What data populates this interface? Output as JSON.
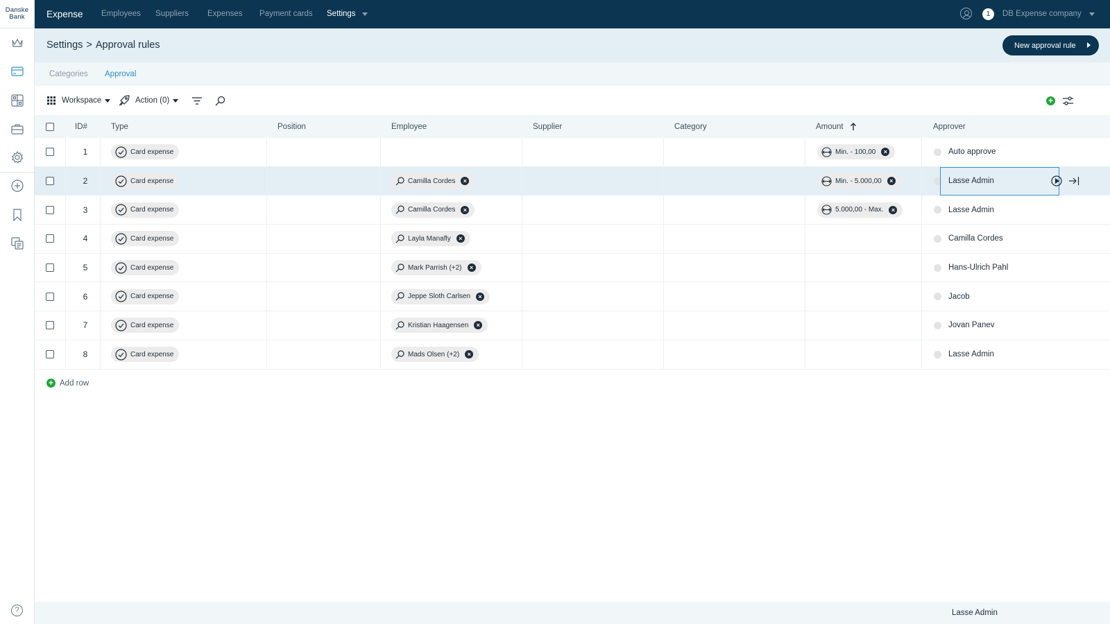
{
  "brand": {
    "line1": "Danske",
    "line2": "Bank"
  },
  "topbar": {
    "app_title": "Expense",
    "nav": [
      {
        "label": "Employees"
      },
      {
        "label": "Suppliers"
      },
      {
        "label": "Expenses"
      },
      {
        "label": "Payment cards"
      },
      {
        "label": "Settings"
      }
    ],
    "notification_count": "1",
    "company": "DB Expense company"
  },
  "sidebar": {
    "icons": [
      "crown-icon",
      "card-icon",
      "dashboard-icon",
      "briefcase-icon",
      "gear-icon",
      "plus-circle-icon",
      "bookmark-icon",
      "reports-icon",
      "help-icon"
    ],
    "help_glyph": "?"
  },
  "header": {
    "breadcrumb_parent": "Settings",
    "breadcrumb_sep": ">",
    "breadcrumb_current": "Approval rules",
    "new_button": "New approval rule"
  },
  "subtabs": {
    "categories": "Categories",
    "approval": "Approval"
  },
  "toolbar": {
    "workspace": "Workspace",
    "action": "Action (0)"
  },
  "table": {
    "headers": {
      "id": "ID#",
      "type": "Type",
      "position": "Position",
      "employee": "Employee",
      "supplier": "Supplier",
      "category": "Category",
      "amount": "Amount",
      "approver": "Approver"
    },
    "rows": [
      {
        "id": "1",
        "type": "Card expense",
        "employee": "",
        "amount": "Min. - 100,00",
        "approver": "Auto approve"
      },
      {
        "id": "2",
        "type": "Card expense",
        "employee": "Camilla Cordes",
        "amount": "Min. - 5.000,00",
        "approver": "Lasse Admin"
      },
      {
        "id": "3",
        "type": "Card expense",
        "employee": "Camilla Cordes",
        "amount": "5.000,00 - Max.",
        "approver": "Lasse Admin"
      },
      {
        "id": "4",
        "type": "Card expense",
        "employee": "Layla Manafly",
        "amount": "",
        "approver": "Camilla Cordes"
      },
      {
        "id": "5",
        "type": "Card expense",
        "employee": "Mark Parrish (+2)",
        "amount": "",
        "approver": "Hans-Ulrich Pahl"
      },
      {
        "id": "6",
        "type": "Card expense",
        "employee": "Jeppe Sloth Carlsen",
        "amount": "",
        "approver": "Jacob"
      },
      {
        "id": "7",
        "type": "Card expense",
        "employee": "Kristian Haagensen",
        "amount": "",
        "approver": "Jovan Panev"
      },
      {
        "id": "8",
        "type": "Card expense",
        "employee": "Mads Olsen (+2)",
        "amount": "",
        "approver": "Lasse Admin"
      }
    ],
    "selected_row": "2"
  },
  "add_row": "Add row",
  "footer": {
    "approver": "Lasse Admin"
  },
  "colors": {
    "nav_bg": "#0b3551",
    "accent": "#2e8fc1",
    "green": "#23a63a"
  }
}
